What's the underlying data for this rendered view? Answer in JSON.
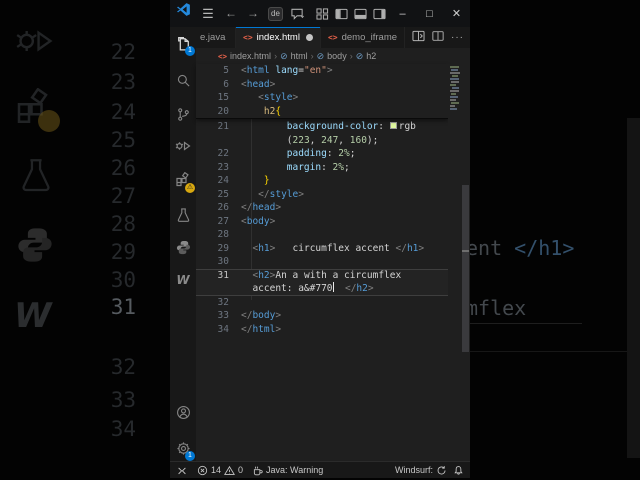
{
  "titlebar": {
    "search_value": "de"
  },
  "tabs": {
    "partial_label": "e.java",
    "active_label": "index.html",
    "inactive_label": "demo_iframe",
    "more_label": "···"
  },
  "breadcrumb": {
    "items": [
      "index.html",
      "html",
      "body",
      "h2"
    ]
  },
  "activity": {
    "explorer_badge": "1",
    "extensions_badge": "⚠",
    "settings_badge": "1",
    "windsurf_glyph": "W"
  },
  "editor": {
    "rows": [
      {
        "num": "5",
        "sticky": true,
        "tokens": [
          {
            "c": "pt",
            "t": "<"
          },
          {
            "c": "tag",
            "t": "html"
          },
          {
            "c": "pl",
            "t": " "
          },
          {
            "c": "attr",
            "t": "lang"
          },
          {
            "c": "op",
            "t": "="
          },
          {
            "c": "str",
            "t": "\"en\""
          },
          {
            "c": "pt",
            "t": ">"
          }
        ]
      },
      {
        "num": "6",
        "sticky": true,
        "tokens": [
          {
            "c": "pt",
            "t": "<"
          },
          {
            "c": "tag",
            "t": "head"
          },
          {
            "c": "pt",
            "t": ">"
          }
        ]
      },
      {
        "num": "15",
        "sticky": true,
        "tokens": [
          {
            "c": "pl",
            "t": "   "
          },
          {
            "c": "pt",
            "t": "<"
          },
          {
            "c": "tag",
            "t": "style"
          },
          {
            "c": "pt",
            "t": ">"
          }
        ]
      },
      {
        "num": "20",
        "sticky": true,
        "tokens": [
          {
            "c": "pl",
            "t": "    "
          },
          {
            "c": "sel",
            "t": "h2"
          },
          {
            "c": "brace",
            "t": "{"
          }
        ]
      },
      {
        "num": "21",
        "tokens": [
          {
            "c": "pl",
            "t": "        "
          },
          {
            "c": "prop",
            "t": "background-color"
          },
          {
            "c": "op",
            "t": ": "
          },
          {
            "c": "swatch",
            "t": ""
          },
          {
            "c": "fn",
            "t": "rgb"
          }
        ]
      },
      {
        "num": "",
        "tokens": [
          {
            "c": "pl",
            "t": "        "
          },
          {
            "c": "op",
            "t": "("
          },
          {
            "c": "num",
            "t": "223"
          },
          {
            "c": "op",
            "t": ", "
          },
          {
            "c": "num",
            "t": "247"
          },
          {
            "c": "op",
            "t": ", "
          },
          {
            "c": "num",
            "t": "160"
          },
          {
            "c": "op",
            "t": ");"
          }
        ]
      },
      {
        "num": "22",
        "tokens": [
          {
            "c": "pl",
            "t": "        "
          },
          {
            "c": "prop",
            "t": "padding"
          },
          {
            "c": "op",
            "t": ": "
          },
          {
            "c": "num",
            "t": "2%"
          },
          {
            "c": "op",
            "t": ";"
          }
        ]
      },
      {
        "num": "23",
        "tokens": [
          {
            "c": "pl",
            "t": "        "
          },
          {
            "c": "prop",
            "t": "margin"
          },
          {
            "c": "op",
            "t": ": "
          },
          {
            "c": "num",
            "t": "2%"
          },
          {
            "c": "op",
            "t": ";"
          }
        ]
      },
      {
        "num": "24",
        "tokens": [
          {
            "c": "pl",
            "t": "    "
          },
          {
            "c": "brace",
            "t": "}"
          }
        ]
      },
      {
        "num": "25",
        "tokens": [
          {
            "c": "pl",
            "t": "   "
          },
          {
            "c": "pt",
            "t": "</"
          },
          {
            "c": "tag",
            "t": "style"
          },
          {
            "c": "pt",
            "t": ">"
          }
        ]
      },
      {
        "num": "26",
        "tokens": [
          {
            "c": "pt",
            "t": "</"
          },
          {
            "c": "tag",
            "t": "head"
          },
          {
            "c": "pt",
            "t": ">"
          }
        ]
      },
      {
        "num": "27",
        "tokens": [
          {
            "c": "pt",
            "t": "<"
          },
          {
            "c": "tag",
            "t": "body"
          },
          {
            "c": "pt",
            "t": ">"
          }
        ]
      },
      {
        "num": "28",
        "tokens": []
      },
      {
        "num": "29",
        "tokens": [
          {
            "c": "pl",
            "t": "  "
          },
          {
            "c": "pt",
            "t": "<"
          },
          {
            "c": "tag",
            "t": "h1"
          },
          {
            "c": "pt",
            "t": ">"
          },
          {
            "c": "pl",
            "t": "   circumflex accent "
          },
          {
            "c": "pt",
            "t": "</"
          },
          {
            "c": "tag",
            "t": "h1"
          },
          {
            "c": "pt",
            "t": ">"
          }
        ]
      },
      {
        "num": "30",
        "tokens": []
      },
      {
        "num": "31",
        "cur": "top",
        "tokens": [
          {
            "c": "pl",
            "t": "  "
          },
          {
            "c": "pt",
            "t": "<"
          },
          {
            "c": "tag",
            "t": "h2"
          },
          {
            "c": "pt",
            "t": ">"
          },
          {
            "c": "pl",
            "t": "An a with a circumflex"
          }
        ]
      },
      {
        "num": "",
        "cur": "bot",
        "tokens": [
          {
            "c": "pl",
            "t": "  accent: a&#770"
          },
          {
            "c": "cursor",
            "t": ""
          },
          {
            "c": "pl",
            "t": "  "
          },
          {
            "c": "pt",
            "t": "</"
          },
          {
            "c": "tag",
            "t": "h2"
          },
          {
            "c": "pt",
            "t": ">"
          }
        ]
      },
      {
        "num": "32",
        "tokens": []
      },
      {
        "num": "33",
        "tokens": [
          {
            "c": "pt",
            "t": "</"
          },
          {
            "c": "tag",
            "t": "body"
          },
          {
            "c": "pt",
            "t": ">"
          }
        ]
      },
      {
        "num": "34",
        "tokens": [
          {
            "c": "pt",
            "t": "</"
          },
          {
            "c": "tag",
            "t": "html"
          },
          {
            "c": "pt",
            "t": ">"
          }
        ]
      }
    ]
  },
  "statusbar": {
    "errors": "14",
    "warnings": "0",
    "java_label": "Java: Warning",
    "windsurf_label": "Windsurf:"
  },
  "colors": {
    "accent_blue": "#0078d4",
    "swatch_green": "#dff7a0",
    "html_icon_orange": "#e8624a"
  },
  "backdrop": {
    "line_numbers": [
      "22",
      "23",
      "24",
      "25",
      "26",
      "27",
      "28",
      "29",
      "30",
      "31",
      "32",
      "33",
      "34"
    ],
    "bright_number": "31",
    "echo_text_plain": "ent ",
    "echo_text_tag": "</h1>",
    "echo_text_2": "mflex",
    "echo_w": "W"
  }
}
